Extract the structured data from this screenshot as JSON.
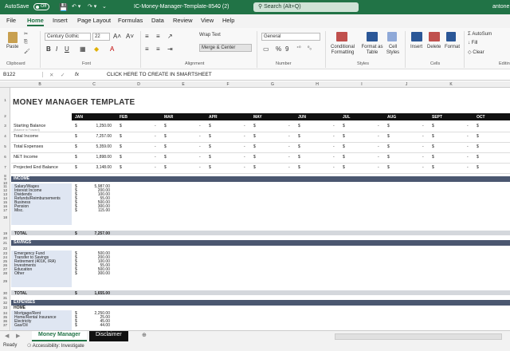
{
  "titlebar": {
    "autosave_label": "AutoSave",
    "autosave_state": "Off",
    "filename": "IC-Money-Manager-Template-8540 (2)",
    "search_placeholder": "Search (Alt+Q)",
    "user": "antone"
  },
  "ribbon_tabs": [
    "File",
    "Home",
    "Insert",
    "Page Layout",
    "Formulas",
    "Data",
    "Review",
    "View",
    "Help"
  ],
  "ribbon": {
    "paste_label": "Paste",
    "font_name": "Century Gothic",
    "font_size": "22",
    "wrap_text": "Wrap Text",
    "merge_center": "Merge & Center",
    "number_format": "General",
    "conditional_formatting": "Conditional Formatting",
    "format_as_table": "Format as Table",
    "cell_styles": "Cell Styles",
    "insert": "Insert",
    "delete": "Delete",
    "format": "Format",
    "autosum": "AutoSum",
    "fill": "Fill",
    "clear": "Clear",
    "editing": "Editin",
    "groups": {
      "clipboard": "Clipboard",
      "font": "Font",
      "alignment": "Alignment",
      "number": "Number",
      "styles": "Styles",
      "cells": "Cells"
    }
  },
  "formula_bar": {
    "cell_ref": "B122",
    "fx": "fx",
    "content": "CLICK HERE TO CREATE IN SMARTSHEET"
  },
  "columns": [
    "B",
    "C",
    "D",
    "E",
    "F",
    "G",
    "H",
    "I",
    "J",
    "K"
  ],
  "sheet": {
    "title": "MONEY MANAGER TEMPLATE",
    "months": [
      "JAN",
      "FEB",
      "MAR",
      "APR",
      "MAY",
      "JUN",
      "JUL",
      "AUG",
      "SEPT",
      "OCT"
    ],
    "summary": [
      {
        "row": "3",
        "label": "Starting Balance",
        "sub": "(Balance to Forward)",
        "jan": "1,250.00"
      },
      {
        "row": "4",
        "label": "Total Income",
        "jan": "7,257.00"
      },
      {
        "row": "5",
        "label": "Total Expenses",
        "jan": "5,359.00"
      },
      {
        "row": "6",
        "label": "NET Income",
        "jan": "1,898.00"
      },
      {
        "row": "7",
        "label": "Projected End Balance",
        "jan": "3,148.00"
      }
    ],
    "income": {
      "header": "INCOME",
      "items": [
        {
          "row": "11",
          "label": "Salary/Wages",
          "value": "5,987.00"
        },
        {
          "row": "12",
          "label": "Interest Income",
          "value": "200.00"
        },
        {
          "row": "13",
          "label": "Dividends",
          "value": "100.00"
        },
        {
          "row": "14",
          "label": "Refunds/Reimbursements",
          "value": "55.00"
        },
        {
          "row": "15",
          "label": "Business",
          "value": "500.00"
        },
        {
          "row": "16",
          "label": "Pension",
          "value": "300.00"
        },
        {
          "row": "17",
          "label": "Misc.",
          "value": "115.00"
        }
      ],
      "total_label": "TOTAL",
      "total": "7,257.00"
    },
    "savings": {
      "header": "SAVINGS",
      "items": [
        {
          "row": "23",
          "label": "Emergency Fund",
          "value": "500.00"
        },
        {
          "row": "24",
          "label": "Transfer to Savings",
          "value": "200.00"
        },
        {
          "row": "25",
          "label": "Retirement (401K, IRA)",
          "value": "100.00"
        },
        {
          "row": "26",
          "label": "Investments",
          "value": "55.00"
        },
        {
          "row": "27",
          "label": "Education",
          "value": "500.00"
        },
        {
          "row": "28",
          "label": "Other",
          "value": "300.00"
        }
      ],
      "total_label": "TOTAL",
      "total": "1,655.00"
    },
    "expenses": {
      "header": "EXPENSES",
      "sub": "HOME",
      "items": [
        {
          "row": "34",
          "label": "Mortgage/Rent",
          "value": "2,250.00"
        },
        {
          "row": "35",
          "label": "Home/Rental Insurance",
          "value": "25.00"
        },
        {
          "row": "36",
          "label": "Electricity",
          "value": "45.00"
        },
        {
          "row": "37",
          "label": "Gas/Oil",
          "value": "44.00"
        }
      ]
    },
    "currency": "$",
    "dash": "-"
  },
  "sheet_tabs": [
    "Money Manager",
    "Disclaimer"
  ],
  "status": {
    "ready": "Ready",
    "accessibility": "Accessibility: Investigate"
  }
}
